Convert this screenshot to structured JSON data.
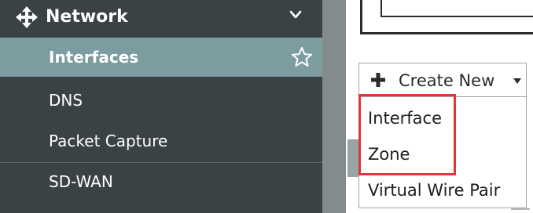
{
  "sidebar": {
    "section": {
      "title": "Network",
      "icon": "move-arrows-icon"
    },
    "items": [
      {
        "label": "Interfaces",
        "active": true,
        "favorite_icon": "star-outline-icon"
      },
      {
        "label": "DNS",
        "active": false
      },
      {
        "label": "Packet Capture",
        "active": false
      },
      {
        "label": "SD-WAN",
        "active": false
      }
    ]
  },
  "toolbar": {
    "create_new_label": "Create New",
    "create_new_icon": "plus-icon",
    "dropdown_icon": "caret-down-icon"
  },
  "dropdown_menu": {
    "items": [
      {
        "label": "Interface"
      },
      {
        "label": "Zone"
      },
      {
        "label": "Virtual Wire Pair"
      }
    ]
  },
  "colors": {
    "sidebar_bg": "#3a4245",
    "active_item_bg": "#7c9c9f",
    "highlight_border": "#e5333a",
    "text_light": "#ffffff",
    "text_dark": "#1e1e1e"
  }
}
